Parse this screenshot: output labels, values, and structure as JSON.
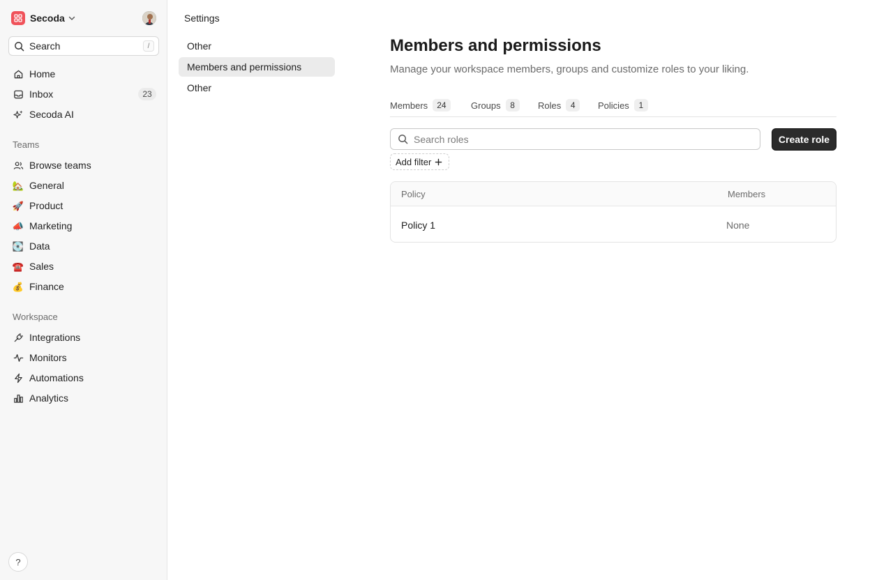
{
  "workspace": {
    "name": "Secoda"
  },
  "search": {
    "label": "Search",
    "shortcut": "/"
  },
  "nav": {
    "items": [
      {
        "label": "Home",
        "icon": "home-icon"
      },
      {
        "label": "Inbox",
        "icon": "inbox-icon",
        "badge": "23"
      },
      {
        "label": "Secoda AI",
        "icon": "sparkle-icon"
      }
    ]
  },
  "teams": {
    "heading": "Teams",
    "items": [
      {
        "label": "Browse teams",
        "icon": "people-icon"
      },
      {
        "label": "General",
        "emoji": "🏡"
      },
      {
        "label": "Product",
        "emoji": "🚀"
      },
      {
        "label": "Marketing",
        "emoji": "📣"
      },
      {
        "label": "Data",
        "emoji": "💽"
      },
      {
        "label": "Sales",
        "emoji": "☎️"
      },
      {
        "label": "Finance",
        "emoji": "💰"
      }
    ]
  },
  "workspace_section": {
    "heading": "Workspace",
    "items": [
      {
        "label": "Integrations",
        "icon": "plug-icon"
      },
      {
        "label": "Monitors",
        "icon": "pulse-icon"
      },
      {
        "label": "Automations",
        "icon": "bolt-icon"
      },
      {
        "label": "Analytics",
        "icon": "bar-chart-icon"
      }
    ]
  },
  "help": {
    "label": "?"
  },
  "settings": {
    "title": "Settings",
    "items": [
      {
        "label": "Other"
      },
      {
        "label": "Members and permissions",
        "active": true
      },
      {
        "label": "Other"
      }
    ]
  },
  "main": {
    "title": "Members and permissions",
    "description": "Manage your workspace members, groups and customize roles to your liking.",
    "tabs": [
      {
        "label": "Members",
        "count": "24"
      },
      {
        "label": "Groups",
        "count": "8"
      },
      {
        "label": "Roles",
        "count": "4"
      },
      {
        "label": "Policies",
        "count": "1"
      }
    ],
    "search_placeholder": "Search roles",
    "create_button": "Create role",
    "add_filter": "Add filter",
    "table": {
      "columns": [
        "Policy",
        "Members"
      ],
      "rows": [
        {
          "policy": "Policy 1",
          "members": "None"
        }
      ]
    }
  },
  "colors": {
    "brand": "#f0525a",
    "primary_button": "#2b2b2b",
    "sidebar_bg": "#f7f7f7",
    "active_item_bg": "#ebebeb"
  }
}
